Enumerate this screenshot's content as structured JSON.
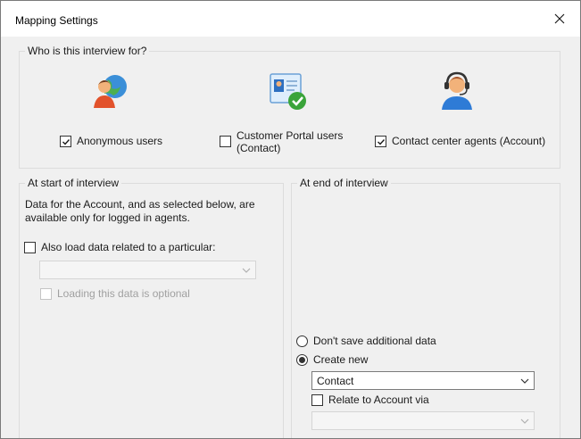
{
  "window": {
    "title": "Mapping Settings"
  },
  "who": {
    "legend": "Who is this interview for?",
    "options": [
      {
        "label": "Anonymous users",
        "checked": true,
        "icon": "anonymous-user-globe-icon"
      },
      {
        "label_line1": "Customer Portal users",
        "label_line2": "(Contact)",
        "checked": false,
        "icon": "customer-portal-contact-card-icon"
      },
      {
        "label": "Contact center agents (Account)",
        "checked": true,
        "icon": "call-center-agent-headset-icon"
      }
    ]
  },
  "start": {
    "legend": "At start of interview",
    "description": "Data for the Account, and as selected below, are available only for logged in agents.",
    "also_load_label": "Also load data related to a particular:",
    "also_load_checked": false,
    "related_select_value": "",
    "optional_label": "Loading this data is optional",
    "optional_checked": false
  },
  "end": {
    "legend": "At end of interview",
    "radio_dont_save": "Don't save additional data",
    "radio_create_new": "Create new",
    "selected_radio": "create_new",
    "create_select_value": "Contact",
    "relate_label": "Relate to Account via",
    "relate_checked": false,
    "relate_select_value": ""
  }
}
